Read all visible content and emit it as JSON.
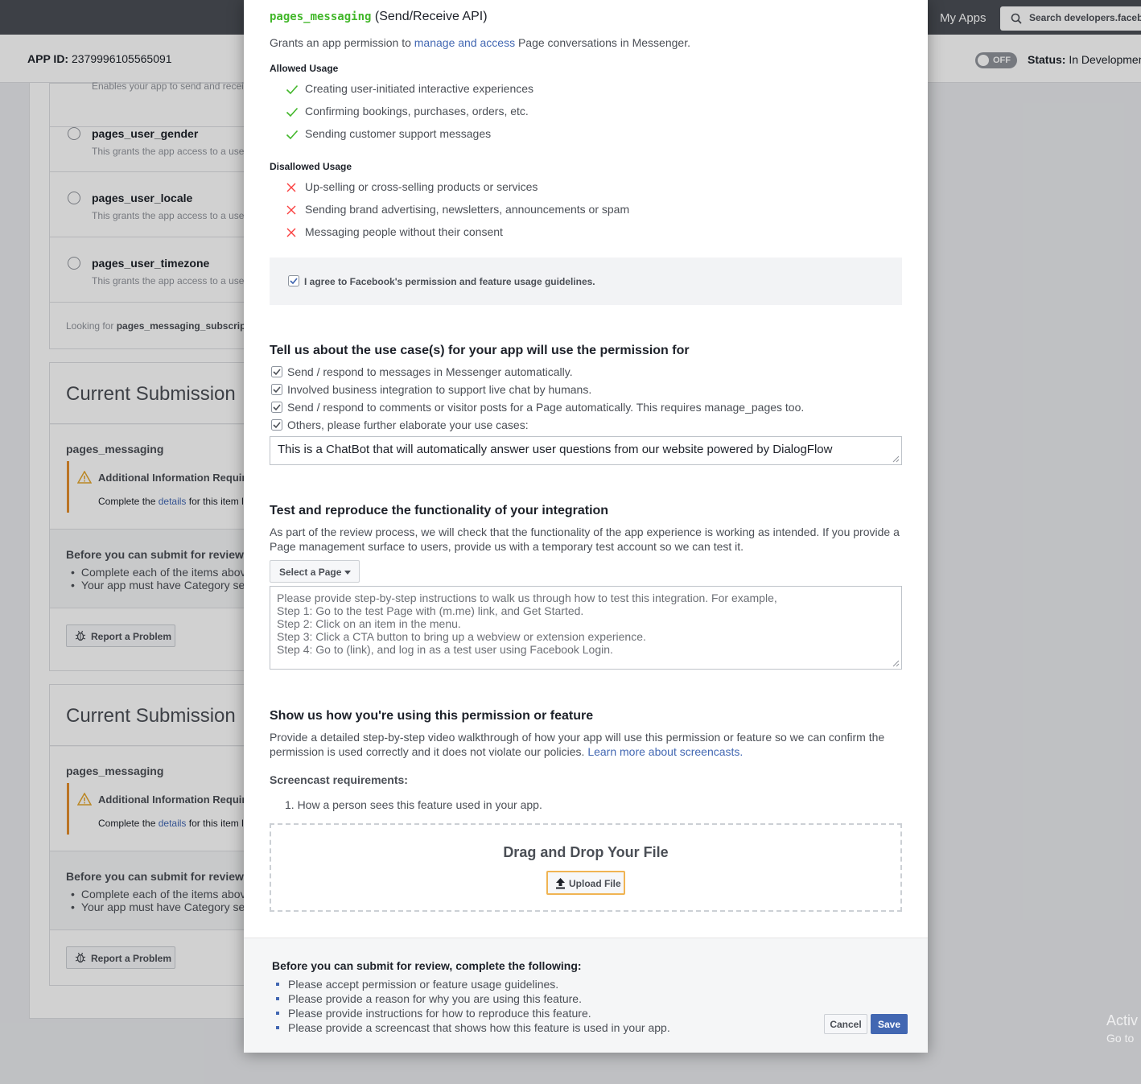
{
  "topbar": {
    "my_apps": "My Apps",
    "search_placeholder": "Search developers.faceb"
  },
  "subbar": {
    "app_id_label": "APP ID:",
    "app_id": "2379996105565091",
    "toggle_label": "OFF",
    "status_label": "Status:",
    "status_value": "In Developmen"
  },
  "background": {
    "truncated_desc": "Enables your app to send and recei",
    "permissions": [
      {
        "name": "pages_user_gender",
        "desc": "This grants the app access to a use"
      },
      {
        "name": "pages_user_locale",
        "desc": "This grants the app access to a use"
      },
      {
        "name": "pages_user_timezone",
        "desc": "This grants the app access to a use"
      }
    ],
    "looking_prefix": "Looking for",
    "looking_perm": "pages_messaging_subscripti",
    "submissions": [
      {
        "title": "Current Submission",
        "perm": "pages_messaging",
        "warn_title": "Additional Information Required",
        "warn_prefix": "Complete the",
        "warn_link": "details",
        "warn_suffix": "for this item l",
        "before": "Before you can submit for review, c",
        "items": [
          "Complete each of the items abov",
          "Your app must have Category se"
        ],
        "report": "Report a Problem"
      },
      {
        "title": "Current Submission",
        "perm": "pages_messaging",
        "warn_title": "Additional Information Required",
        "warn_prefix": "Complete the",
        "warn_link": "details",
        "warn_suffix": "for this item l",
        "before": "Before you can submit for review, c",
        "items": [
          "Complete each of the items abov",
          "Your app must have Category se"
        ],
        "report": "Report a Problem"
      }
    ],
    "watermark_line1": "Activ",
    "watermark_line2": "Go to"
  },
  "modal": {
    "perm_code": "pages_messaging",
    "perm_api": "(Send/Receive API)",
    "grant_prefix": "Grants an app permission to",
    "grant_link": "manage and access",
    "grant_suffix": "Page conversations in Messenger.",
    "allowed_label": "Allowed Usage",
    "allowed": [
      "Creating user-initiated interactive experiences",
      "Confirming bookings, purchases, orders, etc.",
      "Sending customer support messages"
    ],
    "disallowed_label": "Disallowed Usage",
    "disallowed": [
      "Up-selling or cross-selling products or services",
      "Sending brand advertising, newsletters, announcements or spam",
      "Messaging people without their consent"
    ],
    "agree_text": "I agree to Facebook's permission and feature usage guidelines.",
    "usecase_heading": "Tell us about the use case(s) for your app will use the permission for",
    "usecases": [
      "Send / respond to messages in Messenger automatically.",
      "Involved business integration to support live chat by humans.",
      "Send / respond to comments or visitor posts for a Page automatically. This requires manage_pages too.",
      "Others, please further elaborate your use cases:"
    ],
    "other_value": "This is a ChatBot that will automatically answer user questions from our website powered by DialogFlow",
    "test_heading": "Test and reproduce the functionality of your integration",
    "test_desc": "As part of the review process, we will check that the functionality of the app experience is working as intended. If you provide a Page management surface to users, provide us with a temporary test account so we can test it.",
    "select_page": "Select a Page",
    "steps_lines": [
      "Please provide step-by-step instructions to walk us through how to test this integration. For example,",
      "Step 1: Go to the test Page with (m.me) link, and Get Started.",
      "Step 2: Click on an item in the menu.",
      "Step 3: Click a CTA button to bring up a webview or extension experience.",
      "Step 4: Go to (link), and log in as a test user using Facebook Login."
    ],
    "show_heading": "Show us how you're using this permission or feature",
    "show_desc": "Provide a detailed step-by-step video walkthrough of how your app will use this permission or feature so we can confirm the permission is used correctly and it does not violate our policies.",
    "show_link": "Learn more about screencasts.",
    "screencast_label": "Screencast requirements:",
    "screencast_item": "1.  How a person sees this feature used in your app.",
    "drop_title": "Drag and Drop Your File",
    "upload_label": "Upload File",
    "footer_heading": "Before you can submit for review, complete the following:",
    "footer_items": [
      "Please accept permission or feature usage guidelines.",
      "Please provide a reason for why you are using this feature.",
      "Please provide instructions for how to reproduce this feature.",
      "Please provide a screencast that shows how this feature is used in your app."
    ],
    "cancel": "Cancel",
    "save": "Save"
  },
  "colors": {
    "accent": "#4267b2",
    "check": "#42b72a",
    "cross": "#fa3e3e",
    "warning": "#e58e2d"
  }
}
